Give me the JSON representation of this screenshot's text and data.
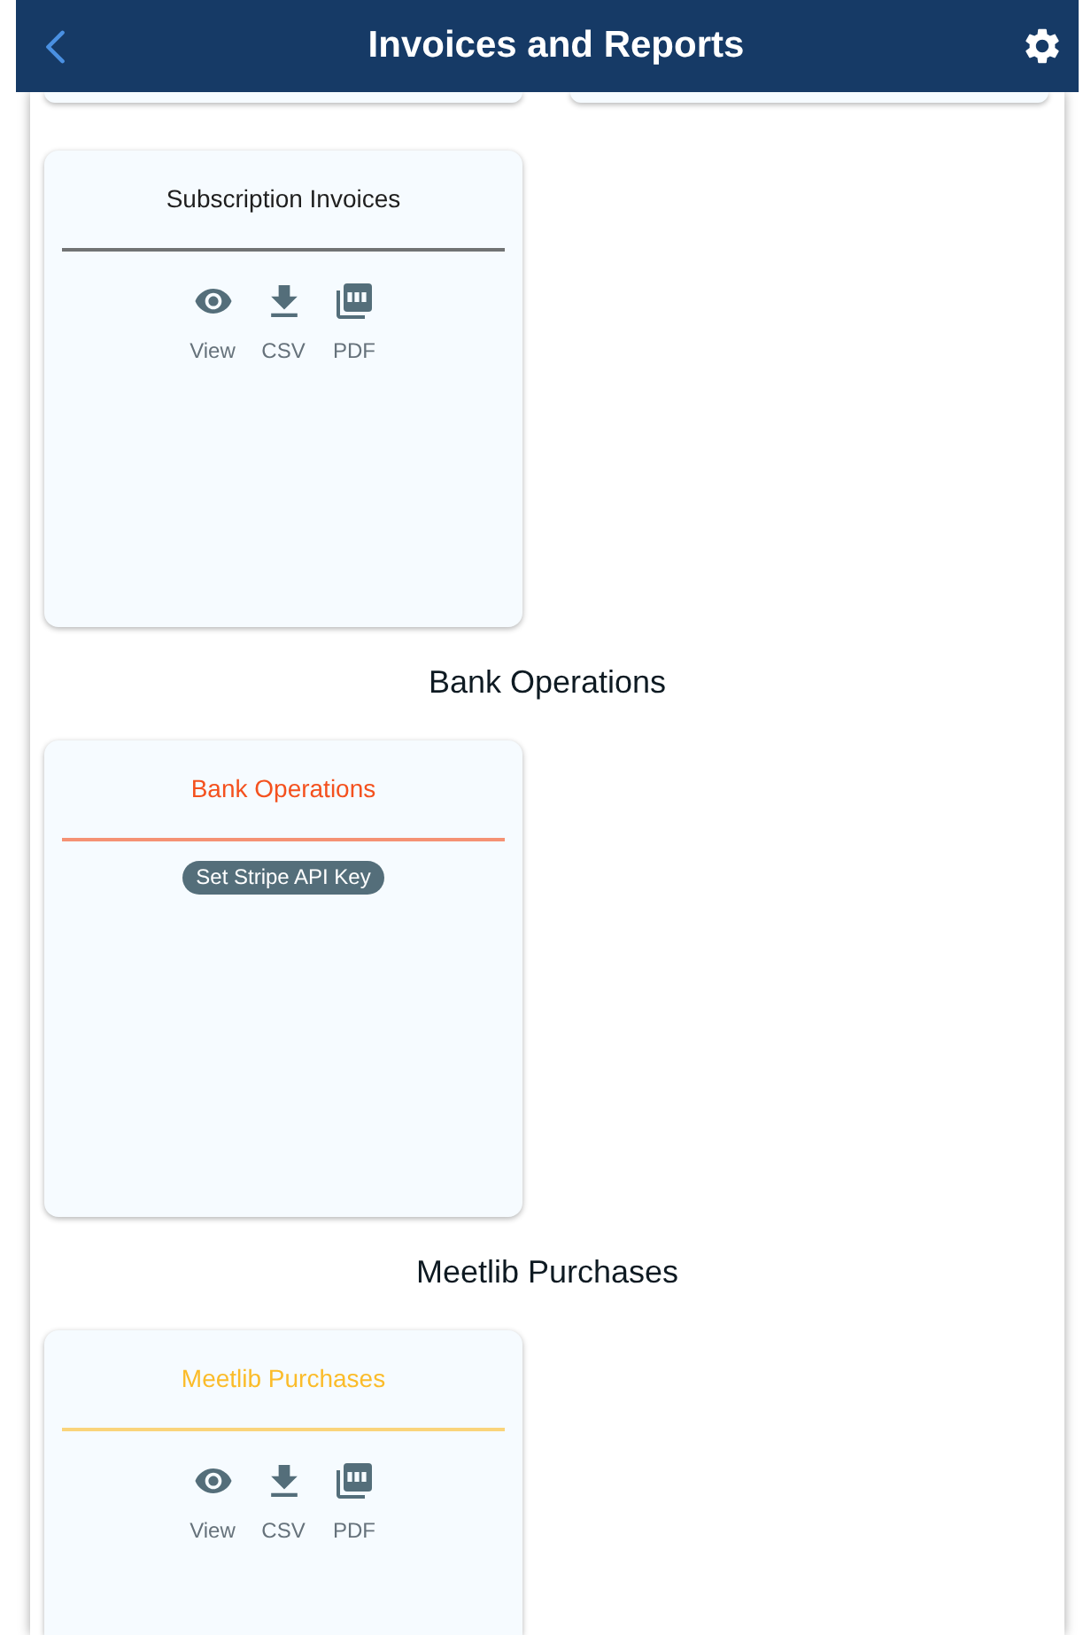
{
  "header": {
    "title": "Invoices and Reports"
  },
  "sections": [
    {
      "cards": [
        {
          "kind": "clipped"
        },
        {
          "kind": "clipped"
        },
        {
          "kind": "actions",
          "title": "Subscription Invoices",
          "color": "#1f1f1f",
          "actions": [
            {
              "kind": "view",
              "label": "View"
            },
            {
              "kind": "csv",
              "label": "CSV"
            },
            {
              "kind": "pdf",
              "label": "PDF"
            }
          ]
        }
      ]
    },
    {
      "heading": "Bank Operations",
      "cards": [
        {
          "kind": "button",
          "title": "Bank Operations",
          "color": "#f4511e",
          "button": "Set Stripe API Key"
        }
      ]
    },
    {
      "heading": "Meetlib Purchases",
      "cards": [
        {
          "kind": "actions",
          "title": "Meetlib Purchases",
          "color": "#fbbc2a",
          "actions": [
            {
              "kind": "view",
              "label": "View"
            },
            {
              "kind": "csv",
              "label": "CSV"
            },
            {
              "kind": "pdf",
              "label": "PDF"
            }
          ]
        }
      ]
    }
  ]
}
